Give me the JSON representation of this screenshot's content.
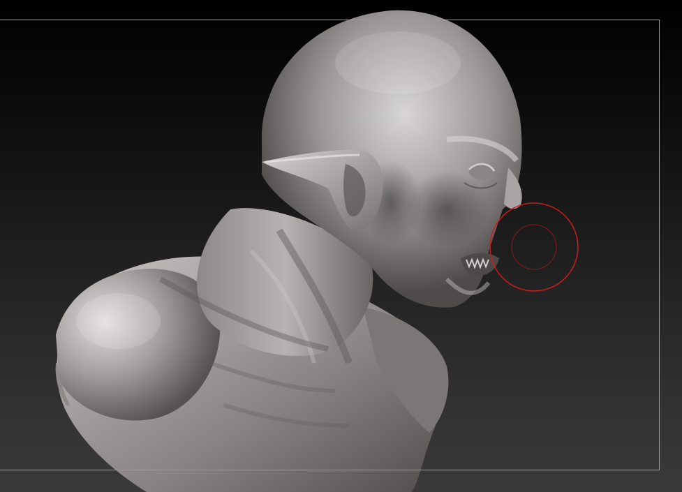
{
  "app": {
    "name": "",
    "view": "3d-sculpt-canvas"
  },
  "canvas": {
    "background_top": "#000000",
    "background_bottom": "#3a3a3a",
    "frame_color": "#9a9a9a"
  },
  "model": {
    "subject": "creature-bust",
    "material_color": "#9e9a9a",
    "highlight_color": "#e6e2e2",
    "shadow_color": "#3e3b3b"
  },
  "brush_cursor": {
    "outer_color": "#cc1c1c",
    "inner_color": "#8a1a1a"
  }
}
